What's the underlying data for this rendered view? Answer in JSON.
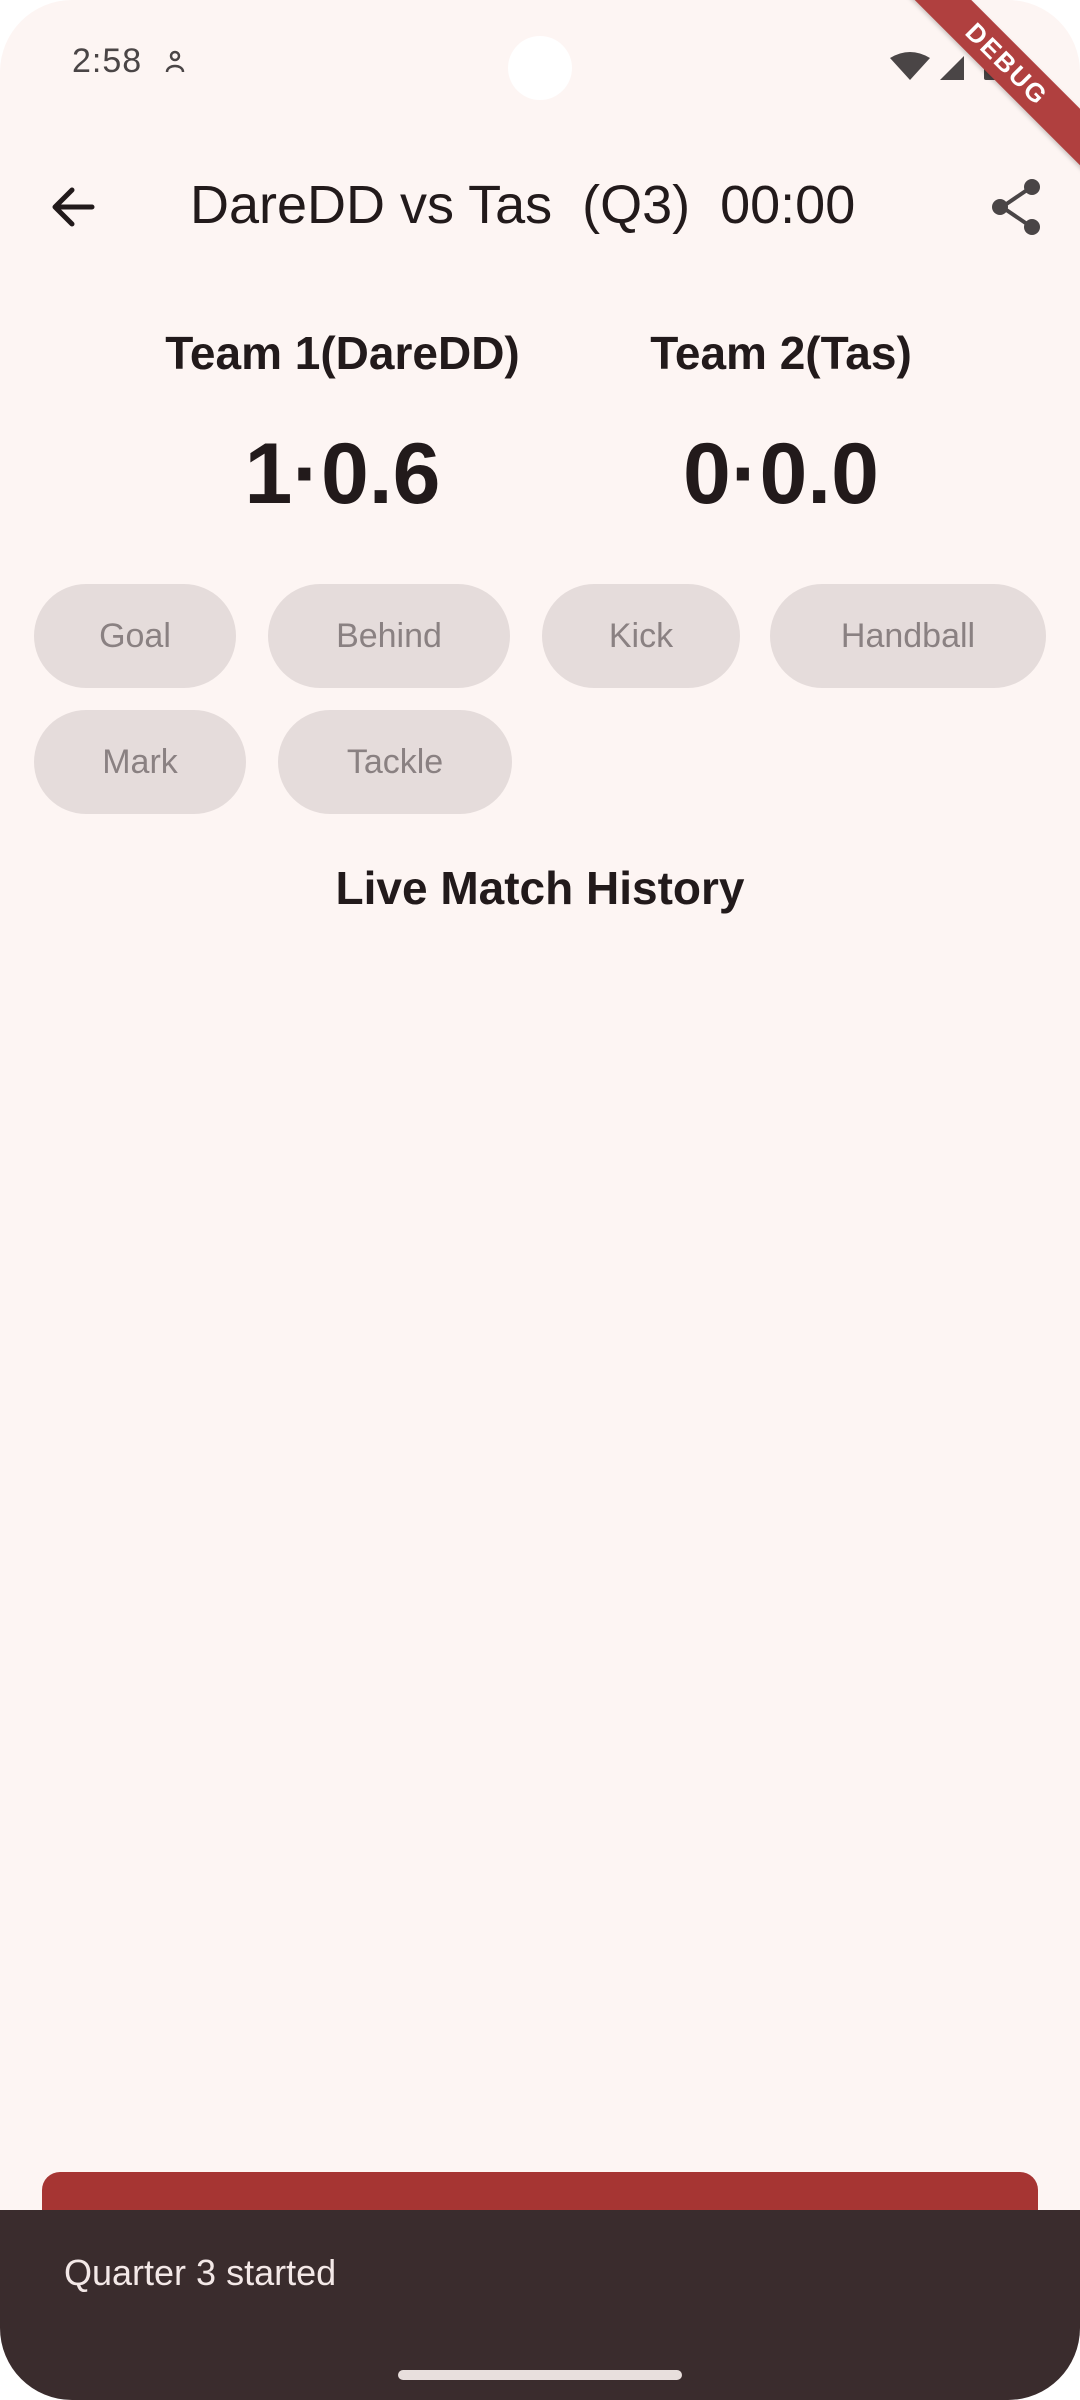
{
  "status_bar": {
    "time": "2:58",
    "icons": [
      "person-icon",
      "wifi-icon",
      "signal-icon",
      "battery-icon"
    ]
  },
  "debug_banner": "DEBUG",
  "app_bar": {
    "title": "DareDD vs Tas  (Q3)  00:00",
    "back_icon": "arrow-back-icon",
    "share_icon": "share-icon"
  },
  "teams": [
    {
      "name": "Team 1(DareDD)",
      "score": "1·0.6"
    },
    {
      "name": "Team 2(Tas)",
      "score": "0·0.0"
    }
  ],
  "actions": {
    "goal": "Goal",
    "behind": "Behind",
    "kick": "Kick",
    "handball": "Handball",
    "mark": "Mark",
    "tackle": "Tackle"
  },
  "history": {
    "title": "Live Match History",
    "items": []
  },
  "snackbar": {
    "message": "Quarter 3 started"
  },
  "colors": {
    "background": "#fdf5f3",
    "chip_background": "#e5dcdb",
    "chip_text": "#8a8182",
    "primary_red": "#a63533",
    "snackbar_background": "#3a2c2d",
    "debug_ribbon": "#b0403f",
    "text": "#221a1b"
  }
}
